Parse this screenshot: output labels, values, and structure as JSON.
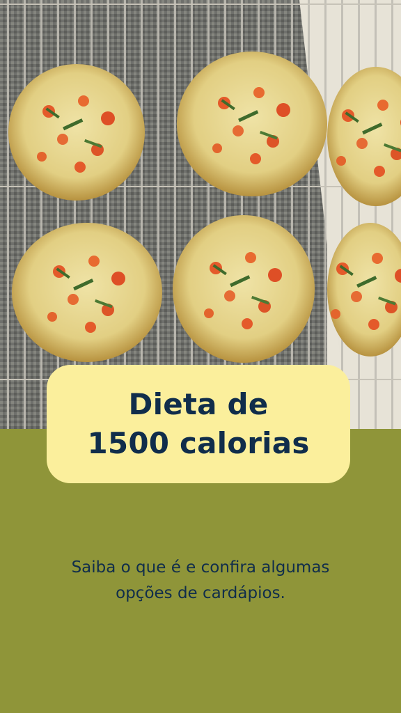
{
  "title": {
    "line1": "Dieta de",
    "line2": "1500 calorias"
  },
  "subtitle": {
    "line1": "Saiba o que é e confira algumas",
    "line2": "opções de cardápios."
  },
  "colors": {
    "background": "#8f9539",
    "card": "#fbef9c",
    "text": "#102d4b"
  },
  "image": {
    "subject": "vegetable egg muffins on a cooling rack"
  }
}
